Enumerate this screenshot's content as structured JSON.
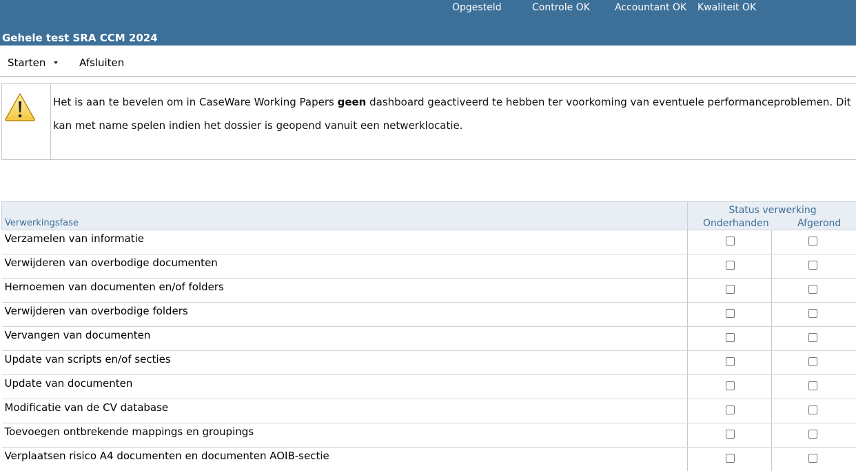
{
  "header": {
    "title": "Gehele test SRA CCM 2024",
    "status_links": [
      "Opgesteld",
      "Controle OK",
      "Accountant OK",
      "Kwaliteit OK"
    ],
    "background_color": "#3d7099"
  },
  "menu": {
    "items": [
      {
        "label": "Starten",
        "has_dropdown": true
      },
      {
        "label": "Afsluiten",
        "has_dropdown": false
      }
    ]
  },
  "warning": {
    "icon": "warning-triangle-icon",
    "text_before": "Het is aan te bevelen om in CaseWare Working Papers ",
    "text_bold": "geen",
    "text_after": " dashboard geactiveerd te hebben ter voorkoming van eventuele performanceproblemen. Dit kan met name spelen indien het dossier is geopend vanuit een netwerklocatie."
  },
  "table": {
    "phase_header": "Verwerkingsfase",
    "status_header": "Status verwerking",
    "status_columns": [
      "Onderhanden",
      "Afgerond"
    ],
    "rows": [
      {
        "phase": "Verzamelen van informatie",
        "onderhanden": false,
        "afgerond": false
      },
      {
        "phase": "Verwijderen van overbodige documenten",
        "onderhanden": false,
        "afgerond": false
      },
      {
        "phase": "Hernoemen van documenten en/of folders",
        "onderhanden": false,
        "afgerond": false
      },
      {
        "phase": "Verwijderen van overbodige folders",
        "onderhanden": false,
        "afgerond": false
      },
      {
        "phase": "Vervangen van documenten",
        "onderhanden": false,
        "afgerond": false
      },
      {
        "phase": "Update van scripts en/of secties",
        "onderhanden": false,
        "afgerond": false
      },
      {
        "phase": "Update van documenten",
        "onderhanden": false,
        "afgerond": false
      },
      {
        "phase": "Modificatie van de CV database",
        "onderhanden": false,
        "afgerond": false
      },
      {
        "phase": "Toevoegen ontbrekende mappings en groupings",
        "onderhanden": false,
        "afgerond": false
      },
      {
        "phase": "Verplaatsen risico A4 documenten en documenten AOIB-sectie",
        "onderhanden": false,
        "afgerond": false
      }
    ]
  }
}
